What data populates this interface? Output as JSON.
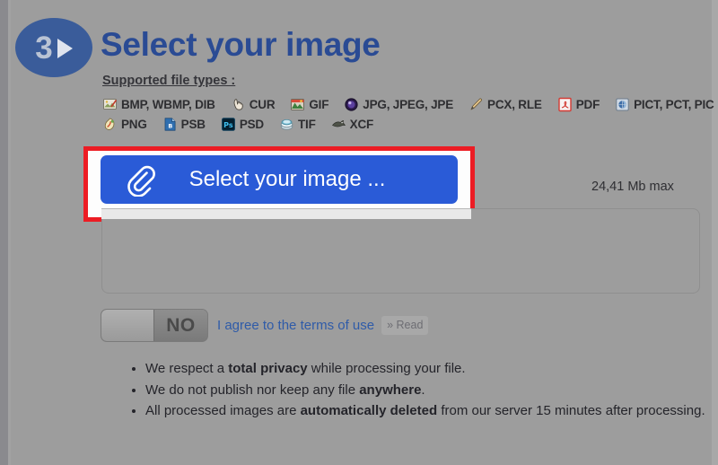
{
  "step": {
    "number": "3",
    "arrow_icon": "play-triangle-icon"
  },
  "header": {
    "title": "Select your image"
  },
  "supported": {
    "label": "Supported file types :",
    "rows": [
      [
        {
          "icon": "bmp-file-icon",
          "label": "BMP, WBMP, DIB"
        },
        {
          "icon": "cur-cursor-icon",
          "label": "CUR"
        },
        {
          "icon": "gif-file-icon",
          "label": "GIF"
        },
        {
          "icon": "jpg-file-icon",
          "label": "JPG, JPEG, JPE"
        },
        {
          "icon": "pcx-file-icon",
          "label": "PCX, RLE"
        },
        {
          "icon": "pdf-file-icon",
          "label": "PDF"
        },
        {
          "icon": "pict-file-icon",
          "label": "PICT, PCT, PIC"
        }
      ],
      [
        {
          "icon": "png-file-icon",
          "label": "PNG"
        },
        {
          "icon": "psb-file-icon",
          "label": "PSB"
        },
        {
          "icon": "psd-file-icon",
          "label": "PSD"
        },
        {
          "icon": "tif-file-icon",
          "label": "TIF"
        },
        {
          "icon": "xcf-file-icon",
          "label": "XCF"
        }
      ]
    ]
  },
  "upload": {
    "button_label": "Select your image ...",
    "button_icon": "paperclip-icon",
    "max_size": "24,41 Mb max",
    "highlight_color": "#ec1c24",
    "button_color": "#2a5bd7"
  },
  "terms": {
    "toggle_state": "NO",
    "agree_label": "I agree to the terms of use",
    "read_label": "» Read"
  },
  "privacy": {
    "items": [
      {
        "pre": "We respect a ",
        "bold": "total privacy",
        "post": " while processing your file."
      },
      {
        "pre": "We do not publish nor keep any file ",
        "bold": "anywhere",
        "post": "."
      },
      {
        "pre": "All processed images are ",
        "bold": "automatically deleted",
        "post": " from our server 15 minutes after processing."
      }
    ]
  }
}
